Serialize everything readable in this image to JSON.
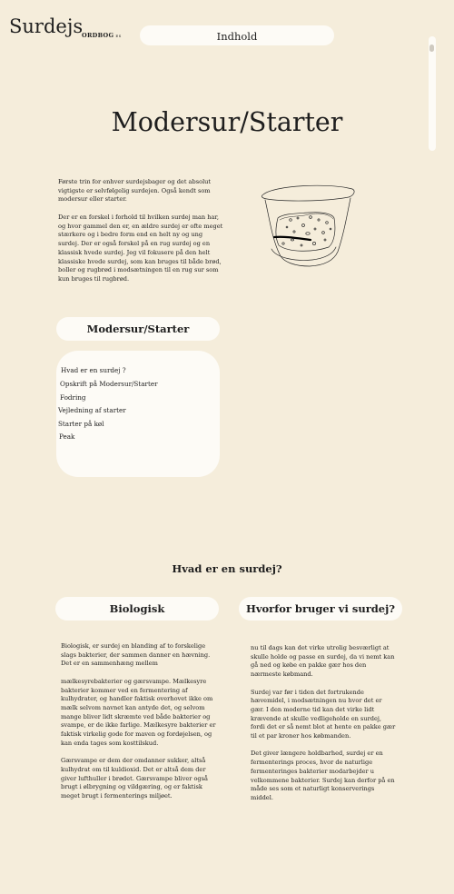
{
  "header": {
    "logo": "Surdejs",
    "logo_sub": "ORDBOG",
    "logo_sub_small": "ES",
    "nav_label": "Indhold"
  },
  "hero": {
    "title": "Modersur/Starter",
    "intro_1": "Første trin for enhver surdejsbager og det absolut vigtigste er selvfølgelig surdejen. Også kendt som modersur eller starter.",
    "intro_2": "Der er en forskel i forhold til hvilken surdej man har, og hvor gammel den er, en ældre surdej er ofte meget stærkere og i bedre form end en helt ny og ung surdej. Der er også forskel på en rug surdej og en klassisk hvede surdej. Jeg vil fokusere på den helt klassiske hvede surdej, som kan bruges til både brød, boller og rugbrød i modsætningen til en rug sur som kun bruges til rugbrød.",
    "image": "sourdough-jar-illustration"
  },
  "toc": {
    "title": "Modersur/Starter",
    "items": [
      "Hvad er en surdej ?",
      "Opskrift på Modersur/Starter",
      "Fodring",
      "Vejledning af starter",
      "Starter på køl",
      "Peak"
    ]
  },
  "section": {
    "title": "Hvad er en surdej?",
    "left_heading": "Biologisk",
    "right_heading": "Hvorfor bruger vi surdej?",
    "left_paragraphs": [
      "Biologisk, er surdej en blanding af to forskelige slags bakterier, der sammen danner en hævning. Det er en sammenhæng mellem",
      "mælkesyrebakterier og gærsvampe. Mælkesyre bakterier kommer ved en fermentering af kulhydrater, og handler faktisk overhovet ikke om mælk selvom navnet kan antyde det, og selvom mange bliver lidt skræmte ved både bakterier og svampe, er de ikke farlige. Mælkesyre bakterier er faktisk virkelig gode for maven og fordøjelsen, og kan enda tages som kosttilskud.",
      "Gærsvampe er dem der omdanner sukker, altså kulhydrat om til kuldioxid. Det er altså dem der giver lufthuller i brødet. Gærsvampe bliver også brugt i ølbrygning og vildgæring, og er faktisk meget brugt i fermenterings miljøet."
    ],
    "right_paragraphs": [
      "nu til dags kan det virke utrolig besværligt at skulle holde og passe en surdej, da vi nemt kan gå ned og købe en pakke gær hos den nærmeste købmand.",
      "Surdej var før i tiden det fortrukende hævemidel, i modsætningen nu hvor det er gær. I den moderne tid kan det virke lidt krævende at skulle vedligeholde en surdej, fordi det er så nemt blot at hente en pakke gær til et par kroner hos købmanden.",
      "Det giver længere holdbarhed, surdej er en fermenterings proces, hvor de naturlige fermenteringes bakterier modarbejder u velkommene bakterier. Surdej kan derfor på en måde ses som et naturligt konserverings middel."
    ]
  }
}
